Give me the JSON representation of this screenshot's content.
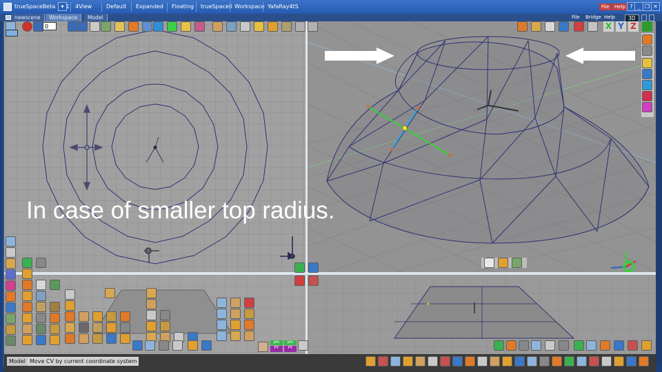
{
  "titlebar": {
    "app_title": "trueSpaceBeta 7.61",
    "tabs": [
      "4View",
      "Default",
      "Expanded",
      "Floating",
      "trueSpace6",
      "Workspace",
      "YafaRay4tS"
    ],
    "top_menu": [
      "File",
      "Help"
    ]
  },
  "subbar": {
    "scene_name": "newscene",
    "tabs": [
      "Workspace",
      "Model"
    ],
    "active_tab": "Workspace",
    "right_menu": [
      "File",
      "Bridge",
      "Help"
    ],
    "view_mode": "3D"
  },
  "timeline": {
    "frame_value": "0"
  },
  "caption": "In case of smaller top radius.",
  "plugin_labels": {
    "a1": "pfx",
    "a2": "PY",
    "b1": "pfx",
    "b2": "PY"
  },
  "axis_buttons": [
    "X",
    "Y",
    "Z"
  ],
  "status": {
    "mode": "Model",
    "message": "Move CV by current coordinate system"
  },
  "colors": {
    "titlebar": "#2f67bf",
    "viewport_grid": "#a1a1a1",
    "wireframe": "#2f3170",
    "selection_green": "#35d13a"
  }
}
